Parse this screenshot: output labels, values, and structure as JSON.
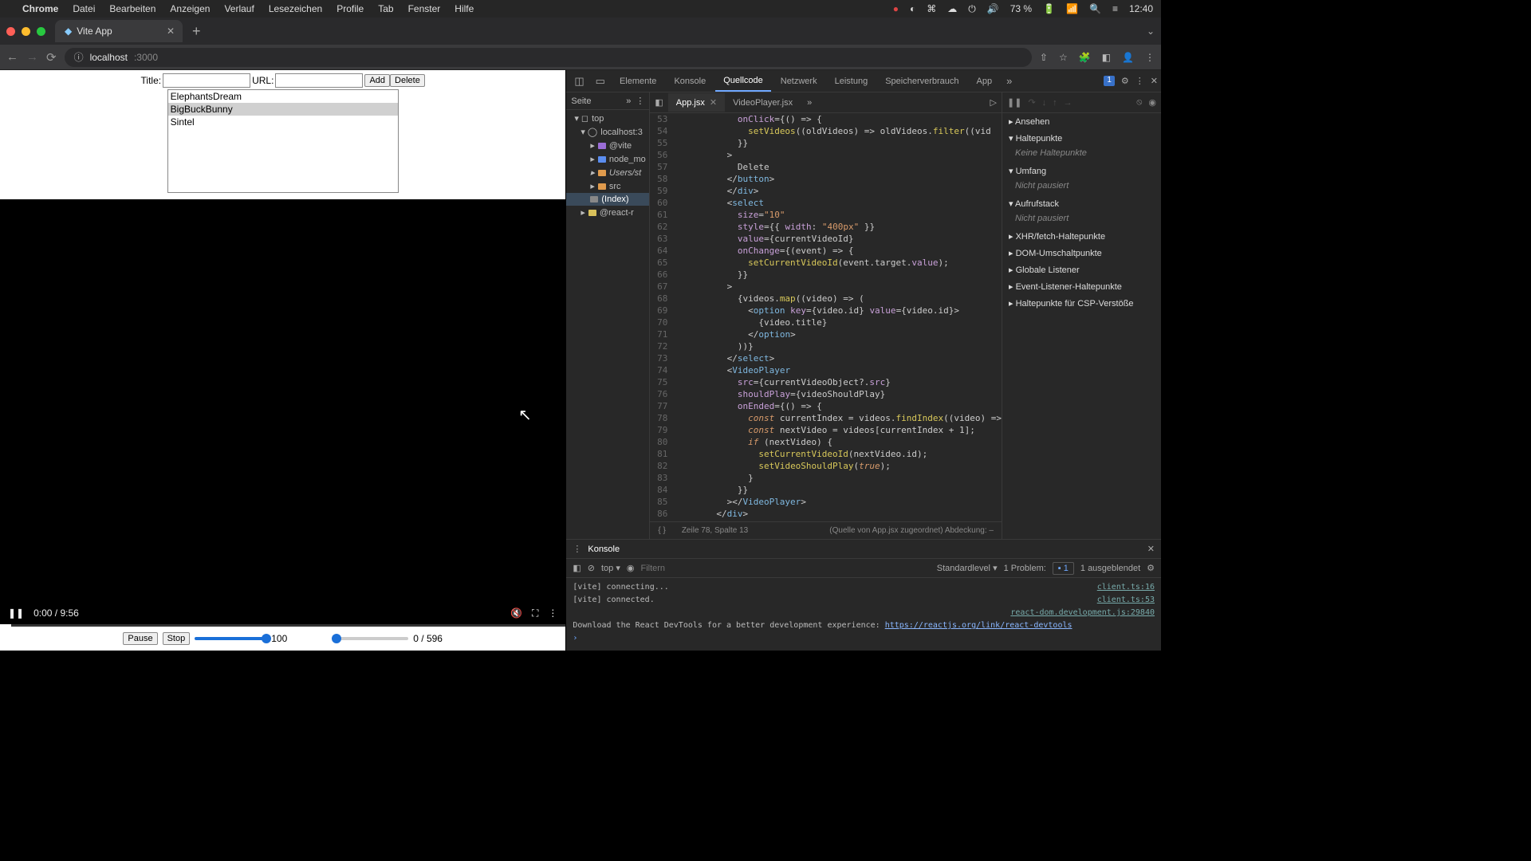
{
  "menubar": {
    "app": "Chrome",
    "items": [
      "Datei",
      "Bearbeiten",
      "Anzeigen",
      "Verlauf",
      "Lesezeichen",
      "Profile",
      "Tab",
      "Fenster",
      "Hilfe"
    ],
    "battery": "73 %",
    "clock": "12:40"
  },
  "tab": {
    "title": "Vite App"
  },
  "address": {
    "host": "localhost",
    "port": ":3000"
  },
  "app": {
    "title_label": "Title:",
    "url_label": "URL:",
    "add": "Add",
    "delete": "Delete",
    "options": [
      "ElephantsDream",
      "BigBuckBunny",
      "Sintel"
    ],
    "selected_index": 1,
    "video_time": "0:00 / 9:56",
    "pause": "Pause",
    "stop": "Stop",
    "volume_value": "100",
    "seek_value": "0 / 596"
  },
  "devtools": {
    "tabs": [
      "Elemente",
      "Konsole",
      "Quellcode",
      "Netzwerk",
      "Leistung",
      "Speicherverbrauch",
      "App"
    ],
    "active_tab": "Quellcode",
    "issues_badge": "1",
    "sources": {
      "side_label": "Seite",
      "tree": {
        "top": "top",
        "host": "localhost:3",
        "vite": "@vite",
        "node": "node_mo",
        "users": "Users/st",
        "src": "src",
        "index": "(Index)",
        "react": "@react-r"
      },
      "file_tabs": [
        "App.jsx",
        "VideoPlayer.jsx"
      ],
      "active_file": "App.jsx",
      "status": {
        "pos": "Zeile 78, Spalte 13",
        "map": "(Quelle von App.jsx zugeordnet)  Abdeckung: –"
      },
      "code": [
        {
          "n": 53,
          "t": "            onClick={() => {"
        },
        {
          "n": 54,
          "t": "              setVideos((oldVideos) => oldVideos.filter((vid"
        },
        {
          "n": 55,
          "t": "            }}"
        },
        {
          "n": 56,
          "t": "          >"
        },
        {
          "n": 57,
          "t": "            Delete"
        },
        {
          "n": 58,
          "t": "          </button>"
        },
        {
          "n": 59,
          "t": "          </div>"
        },
        {
          "n": 60,
          "t": "          <select"
        },
        {
          "n": 61,
          "t": "            size=\"10\""
        },
        {
          "n": 62,
          "t": "            style={{ width: \"400px\" }}"
        },
        {
          "n": 63,
          "t": "            value={currentVideoId}"
        },
        {
          "n": 64,
          "t": "            onChange={(event) => {"
        },
        {
          "n": 65,
          "t": "              setCurrentVideoId(event.target.value);"
        },
        {
          "n": 66,
          "t": "            }}"
        },
        {
          "n": 67,
          "t": "          >"
        },
        {
          "n": 68,
          "t": "            {videos.map((video) => ("
        },
        {
          "n": 69,
          "t": "              <option key={video.id} value={video.id}>"
        },
        {
          "n": 70,
          "t": "                {video.title}"
        },
        {
          "n": 71,
          "t": "              </option>"
        },
        {
          "n": 72,
          "t": "            ))}"
        },
        {
          "n": 73,
          "t": "          </select>"
        },
        {
          "n": 74,
          "t": "          <VideoPlayer"
        },
        {
          "n": 75,
          "t": "            src={currentVideoObject?.src}"
        },
        {
          "n": 76,
          "t": "            shouldPlay={videoShouldPlay}"
        },
        {
          "n": 77,
          "t": "            onEnded={() => {"
        },
        {
          "n": 78,
          "t": "              const currentIndex = videos.findIndex((video) =>"
        },
        {
          "n": 79,
          "t": "              const nextVideo = videos[currentIndex + 1];"
        },
        {
          "n": 80,
          "t": "              if (nextVideo) {"
        },
        {
          "n": 81,
          "t": "                setCurrentVideoId(nextVideo.id);"
        },
        {
          "n": 82,
          "t": "                setVideoShouldPlay(true);"
        },
        {
          "n": 83,
          "t": "              }"
        },
        {
          "n": 84,
          "t": "            }}"
        },
        {
          "n": 85,
          "t": "          ></VideoPlayer>"
        },
        {
          "n": 86,
          "t": "        </div>"
        }
      ]
    },
    "debugger": {
      "panes": {
        "watch": "Ansehen",
        "breakpoints": "Haltepunkte",
        "breakpoints_empty": "Keine Haltepunkte",
        "scope": "Umfang",
        "scope_empty": "Nicht pausiert",
        "callstack": "Aufrufstack",
        "callstack_empty": "Nicht pausiert",
        "xhr": "XHR/fetch-Haltepunkte",
        "dom": "DOM-Umschaltpunkte",
        "global": "Globale Listener",
        "event": "Event-Listener-Haltepunkte",
        "csp": "Haltepunkte für CSP-Verstöße"
      }
    },
    "console": {
      "tab": "Konsole",
      "context": "top",
      "filter_placeholder": "Filtern",
      "level": "Standardlevel",
      "problems": "1 Problem:",
      "problems_badge": "1",
      "hidden": "1 ausgeblendet",
      "lines": [
        {
          "t": "[vite] connecting...",
          "src": "client.ts:16"
        },
        {
          "t": "[vite] connected.",
          "src": "client.ts:53"
        },
        {
          "t": "",
          "src": "react-dom.development.js:29840"
        },
        {
          "t": "Download the React DevTools for a better development experience: ",
          "link": "https://reactjs.org/link/react-devtools"
        }
      ]
    }
  }
}
